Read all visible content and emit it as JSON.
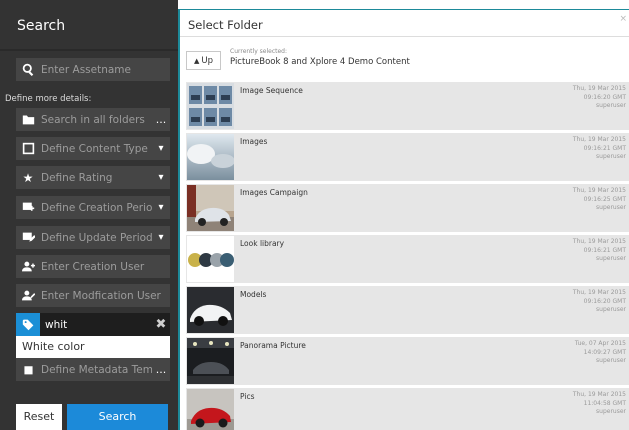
{
  "search": {
    "title": "Search",
    "asset_placeholder": "Enter Assetname",
    "more_details": "Define more details:",
    "fields": {
      "folders": "Search in all folders",
      "content_type": "Define Content Type",
      "rating": "Define Rating",
      "creation_period": "Define Creation Period",
      "update_period": "Define Update Period",
      "creation_user": "Enter Creation User",
      "modification_user": "Enter Modfication User",
      "tag_value": "whit",
      "metadata_template": "Define Metadata Template"
    },
    "dots": "...",
    "suggestion": "White color",
    "reset_label": "Reset",
    "search_label": "Search",
    "accent": "#1c8ad9"
  },
  "modal": {
    "title": "Select Folder",
    "close": "×",
    "up_label": "Up",
    "current_label": "Currently selected:",
    "current_value": "PictureBook 8 and Xplore 4 Demo Content",
    "folders": [
      {
        "name": "Image Sequence",
        "date": "Thu, 19 Mar 2015",
        "time": "09:16:20 GMT",
        "user": "superuser",
        "thumb": "sequence-thumb"
      },
      {
        "name": "Images",
        "date": "Thu, 19 Mar 2015",
        "time": "09:16:21 GMT",
        "user": "superuser",
        "thumb": "sky-thumb"
      },
      {
        "name": "Images Campaign",
        "date": "Thu, 19 Mar 2015",
        "time": "09:16:25 GMT",
        "user": "superuser",
        "thumb": "campaign-thumb"
      },
      {
        "name": "Look library",
        "date": "Thu, 19 Mar 2015",
        "time": "09:16:21 GMT",
        "user": "superuser",
        "thumb": "spheres-thumb"
      },
      {
        "name": "Models",
        "date": "Thu, 19 Mar 2015",
        "time": "09:16:20 GMT",
        "user": "superuser",
        "thumb": "white-car-thumb"
      },
      {
        "name": "Panorama Picture",
        "date": "Tue, 07 Apr 2015",
        "time": "14:09:27 GMT",
        "user": "superuser",
        "thumb": "panorama-thumb"
      },
      {
        "name": "Pics",
        "date": "Thu, 19 Mar 2015",
        "time": "11:04:58 GMT",
        "user": "superuser",
        "thumb": "red-car-thumb"
      }
    ]
  }
}
